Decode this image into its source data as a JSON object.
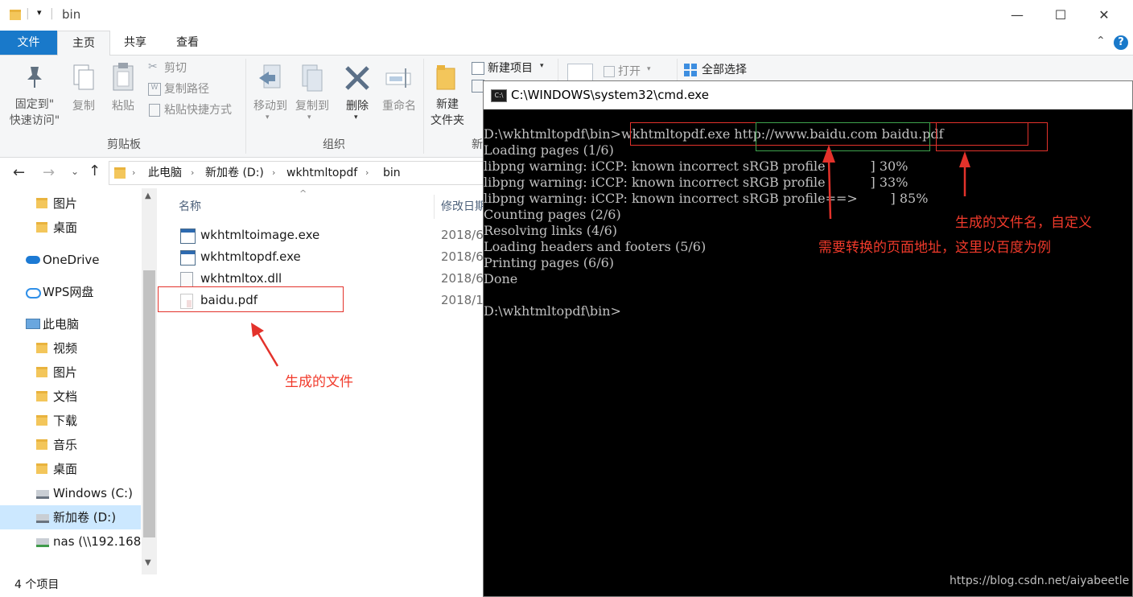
{
  "explorer": {
    "title": "bin",
    "tabs": [
      "文件",
      "主页",
      "共享",
      "查看"
    ],
    "ribbon": {
      "pin_label_1": "固定到\"",
      "pin_label_2": "快速访问\"",
      "copy": "复制",
      "paste": "粘贴",
      "cut": "剪切",
      "copy_path": "复制路径",
      "paste_shortcut": "粘贴快捷方式",
      "clipboard_group": "剪贴板",
      "move_to": "移动到",
      "copy_to": "复制到",
      "delete": "删除",
      "rename": "重命名",
      "organize_group": "组织",
      "new_folder_1": "新建",
      "new_folder_2": "文件夹",
      "new_item": "新建项目",
      "new_group_partial": "新",
      "open": "打开",
      "select_all": "全部选择"
    },
    "breadcrumb": [
      "此电脑",
      "新加卷 (D:)",
      "wkhtmltopdf",
      "bin"
    ],
    "nav": [
      {
        "label": "图片",
        "indent": 1,
        "icon": "folder-icon"
      },
      {
        "label": "桌面",
        "indent": 1,
        "icon": "folder-icon"
      },
      {
        "label": "OneDrive",
        "indent": 0,
        "icon": "cloud-icon"
      },
      {
        "label": "WPS网盘",
        "indent": 0,
        "icon": "cloud-outline-icon"
      },
      {
        "label": "此电脑",
        "indent": 0,
        "icon": "computer-icon"
      },
      {
        "label": "视频",
        "indent": 1,
        "icon": "folder-icon"
      },
      {
        "label": "图片",
        "indent": 1,
        "icon": "folder-icon"
      },
      {
        "label": "文档",
        "indent": 1,
        "icon": "folder-icon"
      },
      {
        "label": "下载",
        "indent": 1,
        "icon": "folder-icon"
      },
      {
        "label": "音乐",
        "indent": 1,
        "icon": "folder-icon"
      },
      {
        "label": "桌面",
        "indent": 1,
        "icon": "folder-icon"
      },
      {
        "label": "Windows (C:)",
        "indent": 1,
        "icon": "drive-icon"
      },
      {
        "label": "新加卷 (D:)",
        "indent": 1,
        "icon": "drive-icon"
      },
      {
        "label": "nas (\\\\192.168.",
        "indent": 1,
        "icon": "network-drive-icon"
      }
    ],
    "columns": {
      "name": "名称",
      "date": "修改日期"
    },
    "files": [
      {
        "name": "wkhtmltoimage.exe",
        "date": "2018/6",
        "icon": "exe-icon"
      },
      {
        "name": "wkhtmltopdf.exe",
        "date": "2018/6",
        "icon": "exe-icon"
      },
      {
        "name": "wkhtmltox.dll",
        "date": "2018/6",
        "icon": "dll-icon"
      },
      {
        "name": "baidu.pdf",
        "date": "2018/1",
        "icon": "pdf-icon"
      }
    ],
    "status": "4 个项目"
  },
  "cmd": {
    "title": "C:\\WINDOWS\\system32\\cmd.exe",
    "lines": [
      "D:\\wkhtmltopdf\\bin>wkhtmltopdf.exe http://www.baidu.com baidu.pdf",
      "Loading pages (1/6)",
      "libpng warning: iCCP: known incorrect sRGB profile           ] 30%",
      "libpng warning: iCCP: known incorrect sRGB profile           ] 33%",
      "libpng warning: iCCP: known incorrect sRGB profile==>        ] 85%",
      "Counting pages (2/6)",
      "Resolving links (4/6)",
      "Loading headers and footers (5/6)",
      "Printing pages (6/6)",
      "Done",
      "",
      "D:\\wkhtmltopdf\\bin>"
    ]
  },
  "annotations": {
    "generated_file": "生成的文件",
    "filename_note": "生成的文件名，自定义",
    "url_note": "需要转换的页面地址，这里以百度为例",
    "watermark": "https://blog.csdn.net/aiyabeetle"
  },
  "colors": {
    "accent": "#1979ca",
    "annotation_red": "#e3322b",
    "annotation_green": "#3fa34d",
    "terminal_bg": "#000000",
    "terminal_fg": "#c0c0c0"
  }
}
